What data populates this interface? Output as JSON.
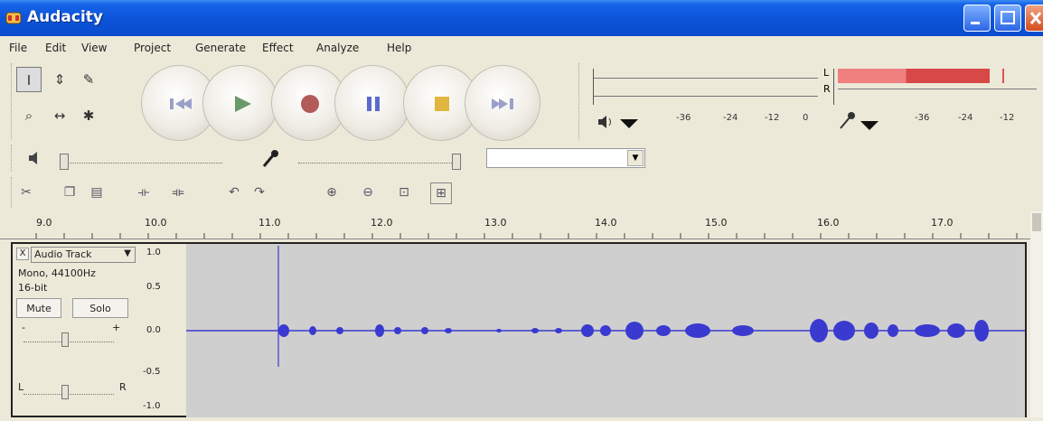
{
  "window": {
    "title": "Audacity"
  },
  "menu": [
    "File",
    "Edit",
    "View",
    "Project",
    "Generate",
    "Effect",
    "Analyze",
    "Help"
  ],
  "transport": [
    "skip-to-start",
    "play",
    "record",
    "pause",
    "stop",
    "skip-to-end"
  ],
  "meters": {
    "output_channels": [
      "L",
      "R"
    ],
    "output_ticks": [
      "-36",
      "-24",
      "-12",
      "0"
    ],
    "input_ticks": [
      "-36",
      "-24",
      "-12"
    ]
  },
  "ruler": {
    "ticks": [
      "9.0",
      "10.0",
      "11.0",
      "12.0",
      "13.0",
      "14.0",
      "15.0",
      "16.0",
      "17.0"
    ]
  },
  "track": {
    "close": "X",
    "name": "Audio Track",
    "menu_arrow": "▼",
    "info_line1": "Mono, 44100Hz",
    "info_line2": "16-bit",
    "mute": "Mute",
    "solo": "Solo",
    "gain_minus": "-",
    "gain_plus": "+",
    "pan_left": "L",
    "pan_right": "R",
    "scale": [
      "1.0",
      "0.5",
      "0.0",
      "-0.5",
      "-1.0"
    ]
  },
  "colors": {
    "waveform": "#3a3ad0",
    "track_bg": "#cfcfcf",
    "meter_peak": "#e05050"
  }
}
